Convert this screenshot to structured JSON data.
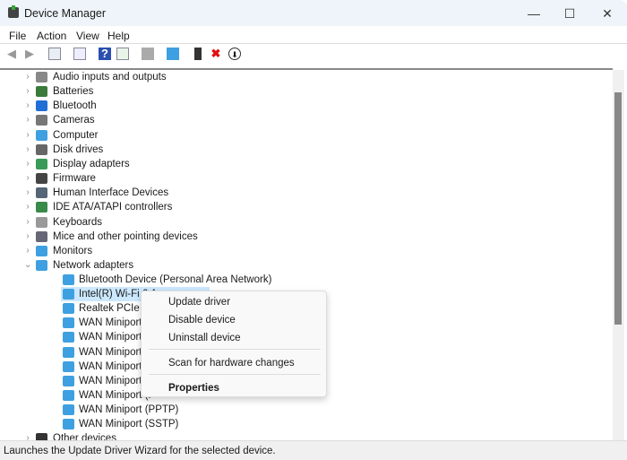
{
  "window": {
    "title": "Device Manager",
    "minimize": "—",
    "maximize": "☐",
    "close": "✕"
  },
  "menu": [
    "File",
    "Action",
    "View",
    "Help"
  ],
  "toolbar_icons": [
    "back-arrow-icon",
    "forward-arrow-icon",
    "show-hide-console-tree-icon",
    "properties-icon",
    "help-icon",
    "action-pane-icon",
    "update-driver-icon",
    "scan-hardware-icon",
    "enable-device-icon",
    "uninstall-icon",
    "disable-device-icon"
  ],
  "tree": {
    "categories": [
      {
        "label": "Audio inputs and outputs",
        "icon": "speaker-icon",
        "color": "#888888"
      },
      {
        "label": "Batteries",
        "icon": "battery-icon",
        "color": "#3a7a3a"
      },
      {
        "label": "Bluetooth",
        "icon": "bluetooth-icon",
        "color": "#1f6fd6"
      },
      {
        "label": "Cameras",
        "icon": "camera-icon",
        "color": "#777777"
      },
      {
        "label": "Computer",
        "icon": "computer-icon",
        "color": "#3ea0e0"
      },
      {
        "label": "Disk drives",
        "icon": "disk-drive-icon",
        "color": "#666666"
      },
      {
        "label": "Display adapters",
        "icon": "display-adapter-icon",
        "color": "#3a9a5a"
      },
      {
        "label": "Firmware",
        "icon": "firmware-icon",
        "color": "#444444"
      },
      {
        "label": "Human Interface Devices",
        "icon": "hid-icon",
        "color": "#556677"
      },
      {
        "label": "IDE ATA/ATAPI controllers",
        "icon": "ide-controller-icon",
        "color": "#3a8a4a"
      },
      {
        "label": "Keyboards",
        "icon": "keyboard-icon",
        "color": "#999999"
      },
      {
        "label": "Mice and other pointing devices",
        "icon": "mouse-icon",
        "color": "#666677"
      },
      {
        "label": "Monitors",
        "icon": "monitor-icon",
        "color": "#3ea0e0"
      },
      {
        "label": "Network adapters",
        "icon": "network-adapter-icon",
        "color": "#3ea0e0",
        "expanded": true
      }
    ],
    "network_children": [
      "Bluetooth Device (Personal Area Network)",
      "Intel(R) Wi-Fi 6 A",
      "Realtek PCIe GbE",
      "WAN Miniport (I",
      "WAN Miniport (I",
      "WAN Miniport (I",
      "WAN Miniport (L",
      "WAN Miniport (N",
      "WAN Miniport (P",
      "WAN Miniport (PPTP)",
      "WAN Miniport (SSTP)"
    ],
    "selected_index": 1,
    "after": {
      "label": "Other devices",
      "icon": "other-devices-icon"
    }
  },
  "context_menu": {
    "update": "Update driver",
    "disable": "Disable device",
    "uninstall": "Uninstall device",
    "scan": "Scan for hardware changes",
    "properties": "Properties"
  },
  "status": "Launches the Update Driver Wizard for the selected device."
}
